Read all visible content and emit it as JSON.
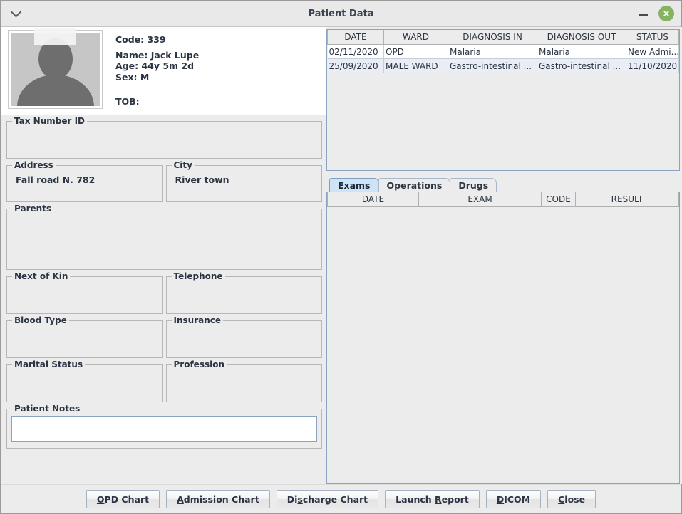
{
  "window": {
    "title": "Patient Data",
    "menu_icon": "chevron-down-icon",
    "minimize_label": "−",
    "close_label": "×",
    "close_color": "#86b361"
  },
  "patient": {
    "photo_alt": "patient-photo-placeholder",
    "code_line": "Code: 339",
    "name_line": "Name: Jack Lupe",
    "age_line": "Age: 44y 5m 2d",
    "sex_line": "Sex: M",
    "tob_line": "TOB:"
  },
  "form": {
    "tax_number_id": {
      "label": "Tax Number ID",
      "value": ""
    },
    "address": {
      "label": "Address",
      "value": "Fall road N. 782"
    },
    "city": {
      "label": "City",
      "value": "River town"
    },
    "parents": {
      "label": "Parents",
      "value": ""
    },
    "next_of_kin": {
      "label": "Next of Kin",
      "value": ""
    },
    "telephone": {
      "label": "Telephone",
      "value": ""
    },
    "blood_type": {
      "label": "Blood Type",
      "value": ""
    },
    "insurance": {
      "label": "Insurance",
      "value": ""
    },
    "marital_status": {
      "label": "Marital Status",
      "value": ""
    },
    "profession": {
      "label": "Profession",
      "value": ""
    },
    "patient_notes": {
      "label": "Patient Notes",
      "value": ""
    }
  },
  "admissions_table": {
    "columns": [
      "DATE",
      "WARD",
      "DIAGNOSIS IN",
      "DIAGNOSIS OUT",
      "STATUS"
    ],
    "rows": [
      {
        "date": "02/11/2020",
        "ward": "OPD",
        "diagnosis_in": "Malaria",
        "diagnosis_out": "Malaria",
        "status": "New Admi..."
      },
      {
        "date": "25/09/2020",
        "ward": "MALE WARD",
        "diagnosis_in": "Gastro-intestinal ...",
        "diagnosis_out": "Gastro-intestinal ...",
        "status": "11/10/2020"
      }
    ]
  },
  "tabs": [
    {
      "label": "Exams",
      "selected": true
    },
    {
      "label": "Operations",
      "selected": false
    },
    {
      "label": "Drugs",
      "selected": false
    }
  ],
  "exams_table": {
    "columns": [
      "DATE",
      "EXAM",
      "CODE",
      "RESULT"
    ],
    "rows": []
  },
  "buttons": [
    {
      "label": "OPD Chart",
      "mnemonic": "O"
    },
    {
      "label": "Admission Chart",
      "mnemonic": "A"
    },
    {
      "label": "Discharge Chart",
      "mnemonic": "s"
    },
    {
      "label": "Launch Report",
      "mnemonic": "R"
    },
    {
      "label": "DICOM",
      "mnemonic": "D"
    },
    {
      "label": "Close",
      "mnemonic": "C"
    }
  ]
}
